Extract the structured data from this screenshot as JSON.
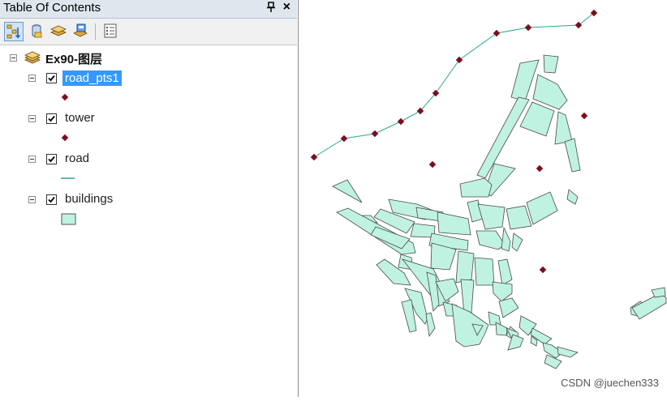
{
  "panel": {
    "title": "Table Of Contents",
    "pin_glyph": "ᅮ",
    "close_glyph": "×"
  },
  "toolbar": {
    "buttons": [
      {
        "name": "list-by-drawing-order-icon",
        "active": true
      },
      {
        "name": "list-by-source-icon",
        "active": false
      },
      {
        "name": "list-by-visibility-icon",
        "active": false
      },
      {
        "name": "list-by-selection-icon",
        "active": false
      },
      {
        "name": "options-icon",
        "active": false
      }
    ]
  },
  "tree": {
    "group_label": "Ex90-图层",
    "layers": [
      {
        "label": "road_pts1",
        "selected": true,
        "checked": true,
        "symbol": "point"
      },
      {
        "label": "tower",
        "selected": false,
        "checked": true,
        "symbol": "point"
      },
      {
        "label": "road",
        "selected": false,
        "checked": true,
        "symbol": "line"
      },
      {
        "label": "buildings",
        "selected": false,
        "checked": true,
        "symbol": "polygon"
      }
    ]
  },
  "colors": {
    "point": "#7a0f1e",
    "line": "#2aa88a",
    "polygon_fill": "#bff2e1",
    "polygon_stroke": "#4a4a4a",
    "selection": "#3399ff"
  },
  "watermark": "CSDN @juechen333"
}
